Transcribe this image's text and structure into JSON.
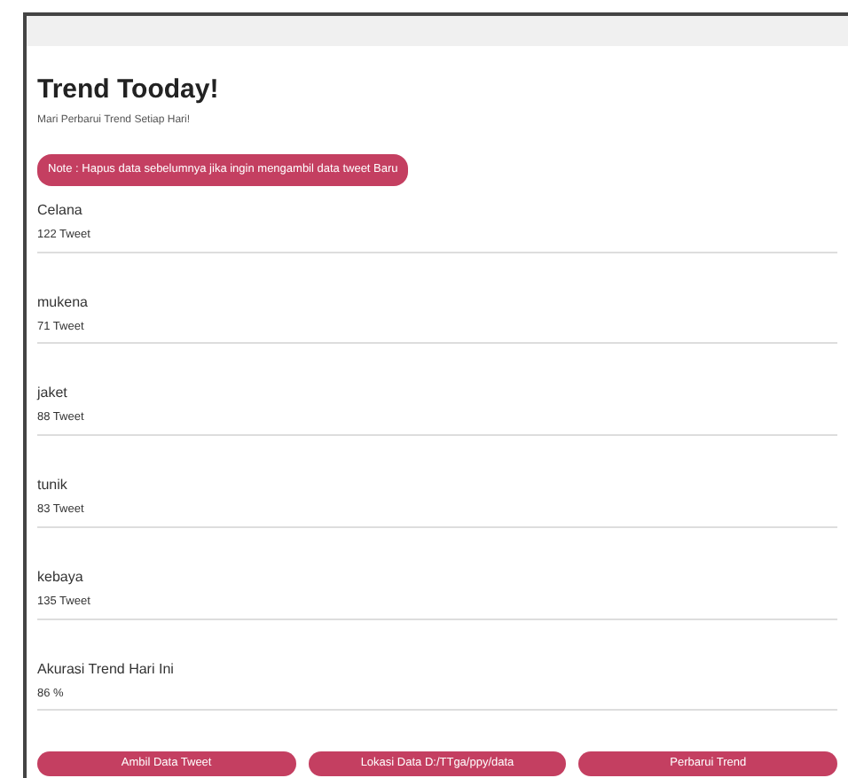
{
  "header": {
    "title": "Trend Tooday!",
    "subtitle": "Mari Perbarui Trend Setiap Hari!",
    "note": "Note : Hapus data sebelumnya jika ingin mengambil data tweet Baru"
  },
  "trends": [
    {
      "name": "Celana",
      "count": "122 Tweet"
    },
    {
      "name": "mukena",
      "count": "71 Tweet"
    },
    {
      "name": "jaket",
      "count": "88 Tweet"
    },
    {
      "name": "tunik",
      "count": "83 Tweet"
    },
    {
      "name": "kebaya",
      "count": "135 Tweet"
    }
  ],
  "accuracy": {
    "label": "Akurasi Trend Hari Ini",
    "value": "86 %"
  },
  "buttons": [
    "Ambil Data Tweet",
    "Lokasi Data D:/TTga/ppy/data",
    "Perbarui Trend"
  ]
}
